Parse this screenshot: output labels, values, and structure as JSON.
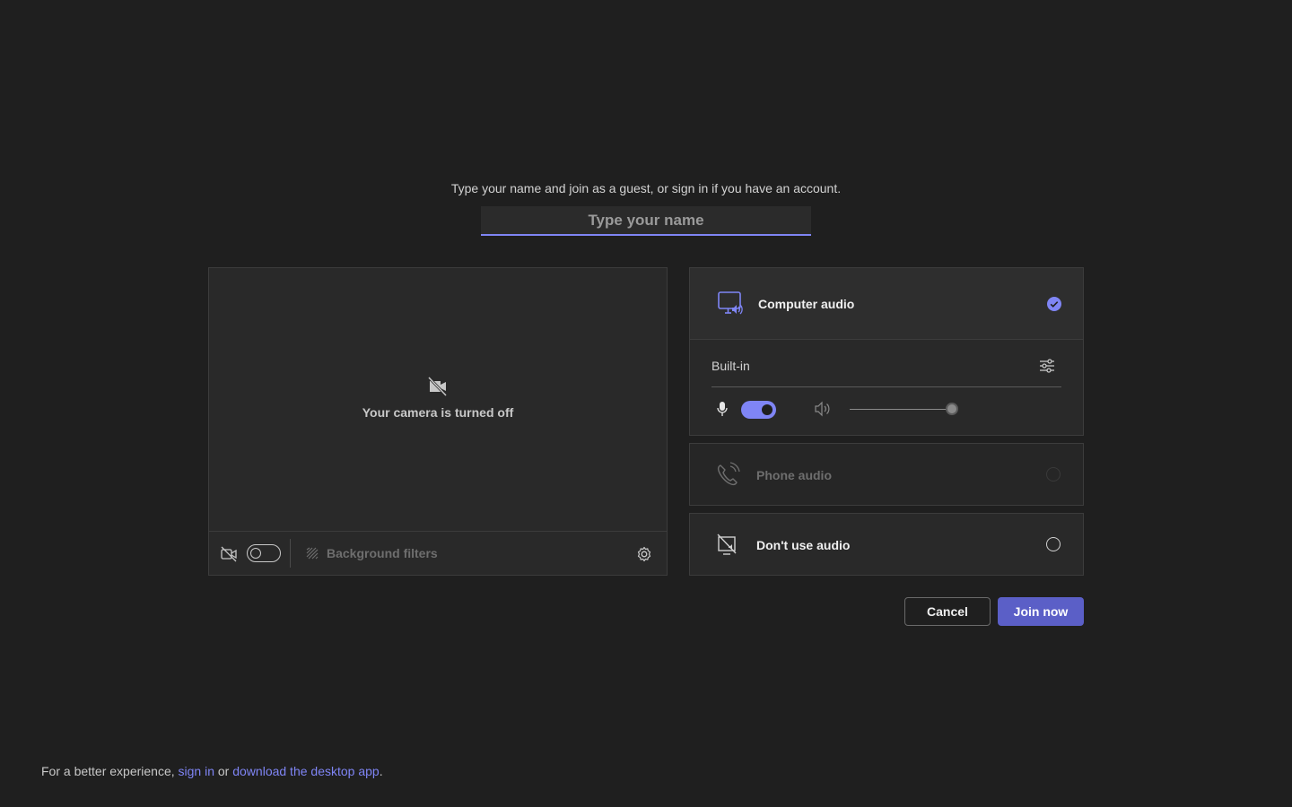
{
  "header": {
    "subtitle": "Type your name and join as a guest, or sign in if you have an account.",
    "name_placeholder": "Type your name"
  },
  "video": {
    "camera_off_text": "Your camera is turned off",
    "camera_toggle_on": false,
    "background_filters_label": "Background filters"
  },
  "audio": {
    "computer": {
      "label": "Computer audio",
      "selected": true,
      "device_label": "Built-in",
      "mic_on": true,
      "volume_fraction": 1.0
    },
    "phone": {
      "label": "Phone audio",
      "disabled": true
    },
    "none": {
      "label": "Don't use audio",
      "selected": false
    }
  },
  "actions": {
    "cancel_label": "Cancel",
    "join_label": "Join now"
  },
  "footer": {
    "prefix": "For a better experience,",
    "sign_in": "sign in",
    "or": "or",
    "download": "download the desktop app",
    "suffix": "."
  },
  "colors": {
    "background": "#1f1f1f",
    "accent": "#7f85f5",
    "primary_button": "#5b5fc7"
  }
}
